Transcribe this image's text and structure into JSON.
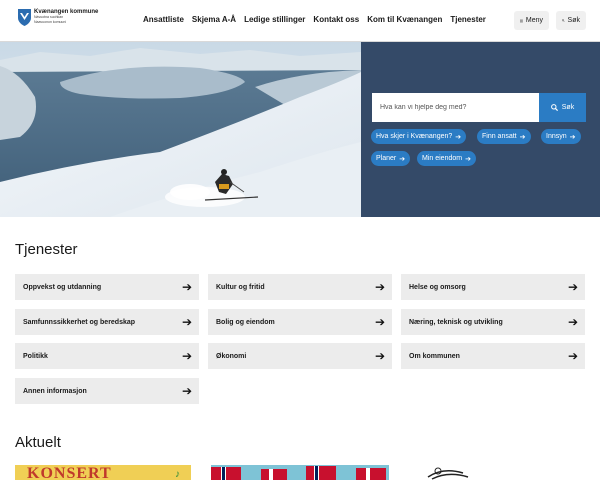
{
  "header": {
    "logo_name": "Kvænangen kommune",
    "logo_sub1": "Návuotna suohkan",
    "logo_sub2": "Naavuonon komuuni",
    "nav": [
      "Ansattliste",
      "Skjema A-Å",
      "Ledige stillinger",
      "Kontakt oss",
      "Kom til Kvænangen",
      "Tjenester"
    ],
    "menu_label": "Meny",
    "search_label": "Søk"
  },
  "hero": {
    "search_placeholder": "Hva kan vi hjelpe deg med?",
    "search_button": "Søk",
    "chips": [
      "Hva skjer i Kvænangen?",
      "Finn ansatt",
      "Innsyn",
      "Planer",
      "Min eiendom"
    ]
  },
  "services": {
    "title": "Tjenester",
    "items": [
      "Oppvekst og utdanning",
      "Kultur og fritid",
      "Helse og omsorg",
      "Samfunnssikkerhet og beredskap",
      "Bolig og eiendom",
      "Næring, teknisk og utvikling",
      "Politikk",
      "Økonomi",
      "Om kommunen",
      "Annen informasjon"
    ]
  },
  "news": {
    "title": "Aktuelt",
    "first_card_text": "KONSERT"
  },
  "colors": {
    "accent": "#2b7cc4",
    "panel": "#344a68",
    "tile": "#ececec"
  }
}
